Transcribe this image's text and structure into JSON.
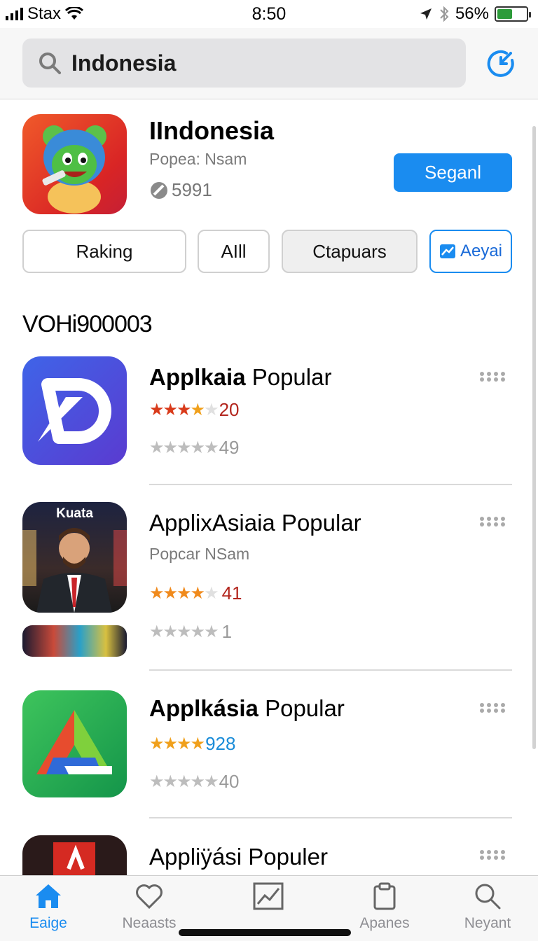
{
  "status_bar": {
    "carrier": "Stax",
    "time": "8:50",
    "battery_percent": "56%"
  },
  "search": {
    "query": "Indonesia"
  },
  "featured": {
    "title": "IIndonesia",
    "subtitle": "Popea: Nsam",
    "count": "5991",
    "button_label": "Seganl"
  },
  "filters": [
    {
      "label": "Raking"
    },
    {
      "label": "AIll"
    },
    {
      "label": "Ctapuars"
    },
    {
      "label": "Aeyai"
    }
  ],
  "section_title": "VOHi900003",
  "apps": [
    {
      "title_bold": "Applkaia",
      "title_rest": " Popular",
      "rating_value": "20",
      "rating_color": "#b3261e",
      "secondary_rating": "49"
    },
    {
      "title_bold": "",
      "title_rest": "ApplixAsiaia Popular",
      "subtitle": "Popcar NSam",
      "icon_caption": "Kuata",
      "rating_value": "41",
      "rating_color": "#b3261e",
      "secondary_rating": "1"
    },
    {
      "title_bold": "Applkásia",
      "title_rest": " Popular",
      "rating_value": "928",
      "rating_color": "#1a8cd8",
      "secondary_rating": "40"
    },
    {
      "title_rest": "Appliÿási Populer"
    }
  ],
  "tabs": [
    {
      "label": "Eaige",
      "icon": "home-icon",
      "active": true
    },
    {
      "label": "Neaasts",
      "icon": "heart-icon"
    },
    {
      "label": "",
      "icon": "chart-icon"
    },
    {
      "label": "Apanes",
      "icon": "clipboard-icon"
    },
    {
      "label": "Neyant",
      "icon": "search-icon"
    }
  ],
  "colors": {
    "accent": "#1a8cf0",
    "star_orange": "#f08a1c",
    "star_gray": "#bdbdbd"
  }
}
